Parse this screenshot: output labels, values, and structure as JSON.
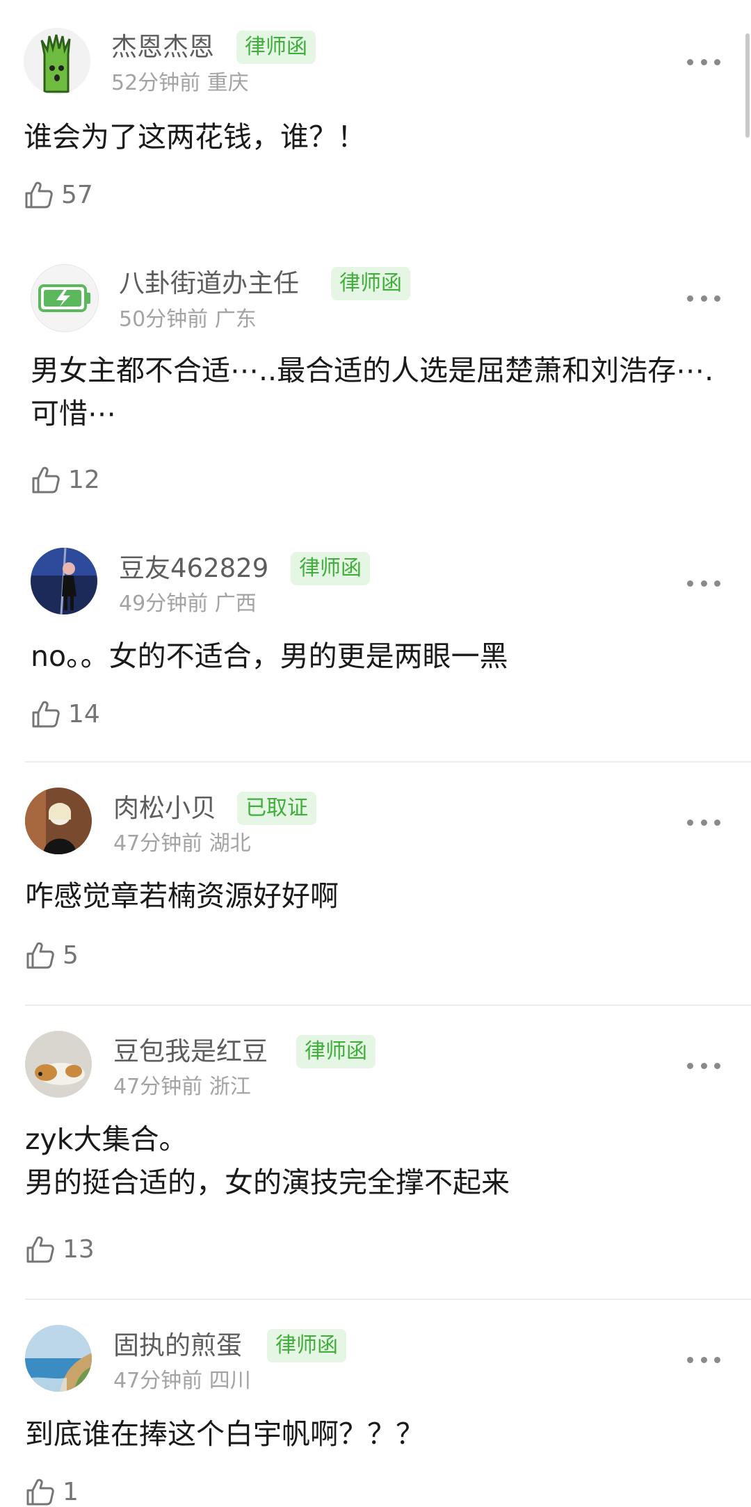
{
  "comments": [
    {
      "username": "杰恩杰恩",
      "badge": "律师函",
      "time": "52分钟前",
      "location": "重庆",
      "text": "谁会为了这两花钱，谁？！",
      "likes": "57",
      "avatar_icon": "green-cactus-cartoon-icon"
    },
    {
      "username": "八卦街道办主任",
      "badge": "律师函",
      "time": "50分钟前",
      "location": "广东",
      "text": "男女主都不合适⋯..最合适的人选是屈楚萧和刘浩存⋯.可惜⋯",
      "likes": "12",
      "avatar_icon": "charging-battery-icon"
    },
    {
      "username": "豆友462829",
      "badge": "律师函",
      "time": "49分钟前",
      "location": "广西",
      "text": "no。。女的不适合，男的更是两眼一黑",
      "likes": "14",
      "avatar_icon": "photo-avatar"
    },
    {
      "username": "肉松小贝",
      "badge": "已取证",
      "time": "47分钟前",
      "location": "湖北",
      "text": "咋感觉章若楠资源好好啊",
      "likes": "5",
      "avatar_icon": "photo-avatar"
    },
    {
      "username": "豆包我是红豆",
      "badge": "律师函",
      "time": "47分钟前",
      "location": "浙江",
      "text": "zyk大集合。\n男的挺合适的，女的演技完全撑不起来",
      "likes": "13",
      "avatar_icon": "dog-photo-avatar"
    },
    {
      "username": "固执的煎蛋",
      "badge": "律师函",
      "time": "47分钟前",
      "location": "四川",
      "text": "到底谁在捧这个白宇帆啊？？？",
      "likes": "1",
      "avatar_icon": "seaside-painting-avatar"
    }
  ],
  "colors": {
    "badge_bg": "#e6f6e4",
    "badge_text": "#3fae3a",
    "username": "#5d5d5d",
    "meta": "#a3a3a3"
  }
}
